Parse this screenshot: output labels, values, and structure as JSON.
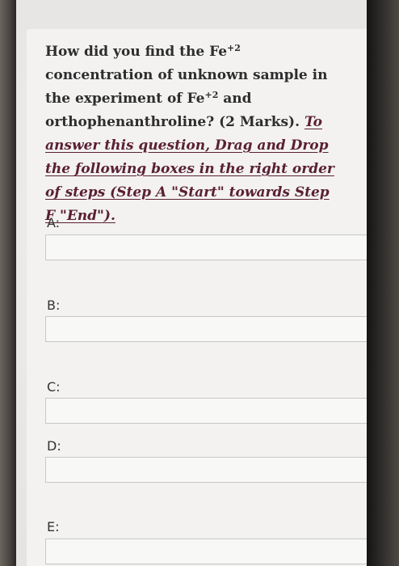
{
  "question": {
    "part1": "How did you find the Fe",
    "charge1": "+2",
    "part2": " concentration of unknown sample in the experiment of Fe",
    "charge2": "+2",
    "part3": " and orthophenanthroline? (2 Marks). ",
    "instruction": "To answer this question, Drag and Drop the following boxes in the right order of steps (Step A \"Start\" towards Step F \"End\")."
  },
  "steps": [
    {
      "label": "A:",
      "value": ""
    },
    {
      "label": "B:",
      "value": ""
    },
    {
      "label": "C:",
      "value": ""
    },
    {
      "label": "D:",
      "value": ""
    },
    {
      "label": "E:",
      "value": ""
    }
  ]
}
